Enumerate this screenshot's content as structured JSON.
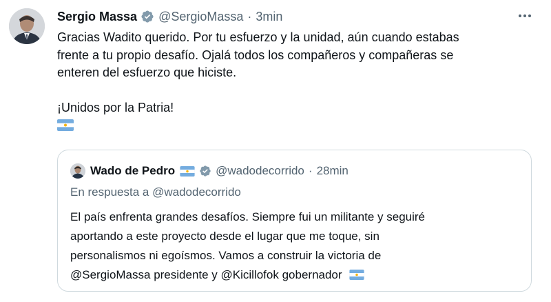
{
  "tweet": {
    "author_name": "Sergio Massa",
    "author_handle": "@SergioMassa",
    "separator": "·",
    "time": "3min",
    "text_lines": [
      "Gracias Wadito querido. Por tu esfuerzo y la unidad, aún cuando estabas",
      "frente a tu propio desafío. Ojalá todos los compañeros y compañeras se",
      "enteren del esfuerzo que hiciste."
    ],
    "closing_line": "¡Unidos por la Patria!",
    "flag_emoji": "argentina-flag"
  },
  "quoted_tweet": {
    "author_name": "Wado de Pedro",
    "author_handle": "@wadodecorrido",
    "separator": "·",
    "time": "28min",
    "reply_prefix": "En respuesta a",
    "reply_to": "@wadodecorrido",
    "text_lines": [
      "El país enfrenta grandes desafíos. Siempre fui un militante y seguiré",
      "aportando a este proyecto desde el lugar que me toque, sin",
      "personalismos ni egoísmos. Vamos a construir la victoria de",
      "@SergioMassa presidente y @Kicillofok gobernador"
    ]
  },
  "icons": {
    "verified": "verified-badge-icon",
    "more": "more-options-icon",
    "flag": "argentina-flag-icon"
  },
  "colors": {
    "text_primary": "#0f1419",
    "text_secondary": "#536471",
    "verified_badge": "#829aab",
    "border": "#cfd9de",
    "flag_blue": "#74acdf",
    "flag_sun": "#f6b40e"
  }
}
